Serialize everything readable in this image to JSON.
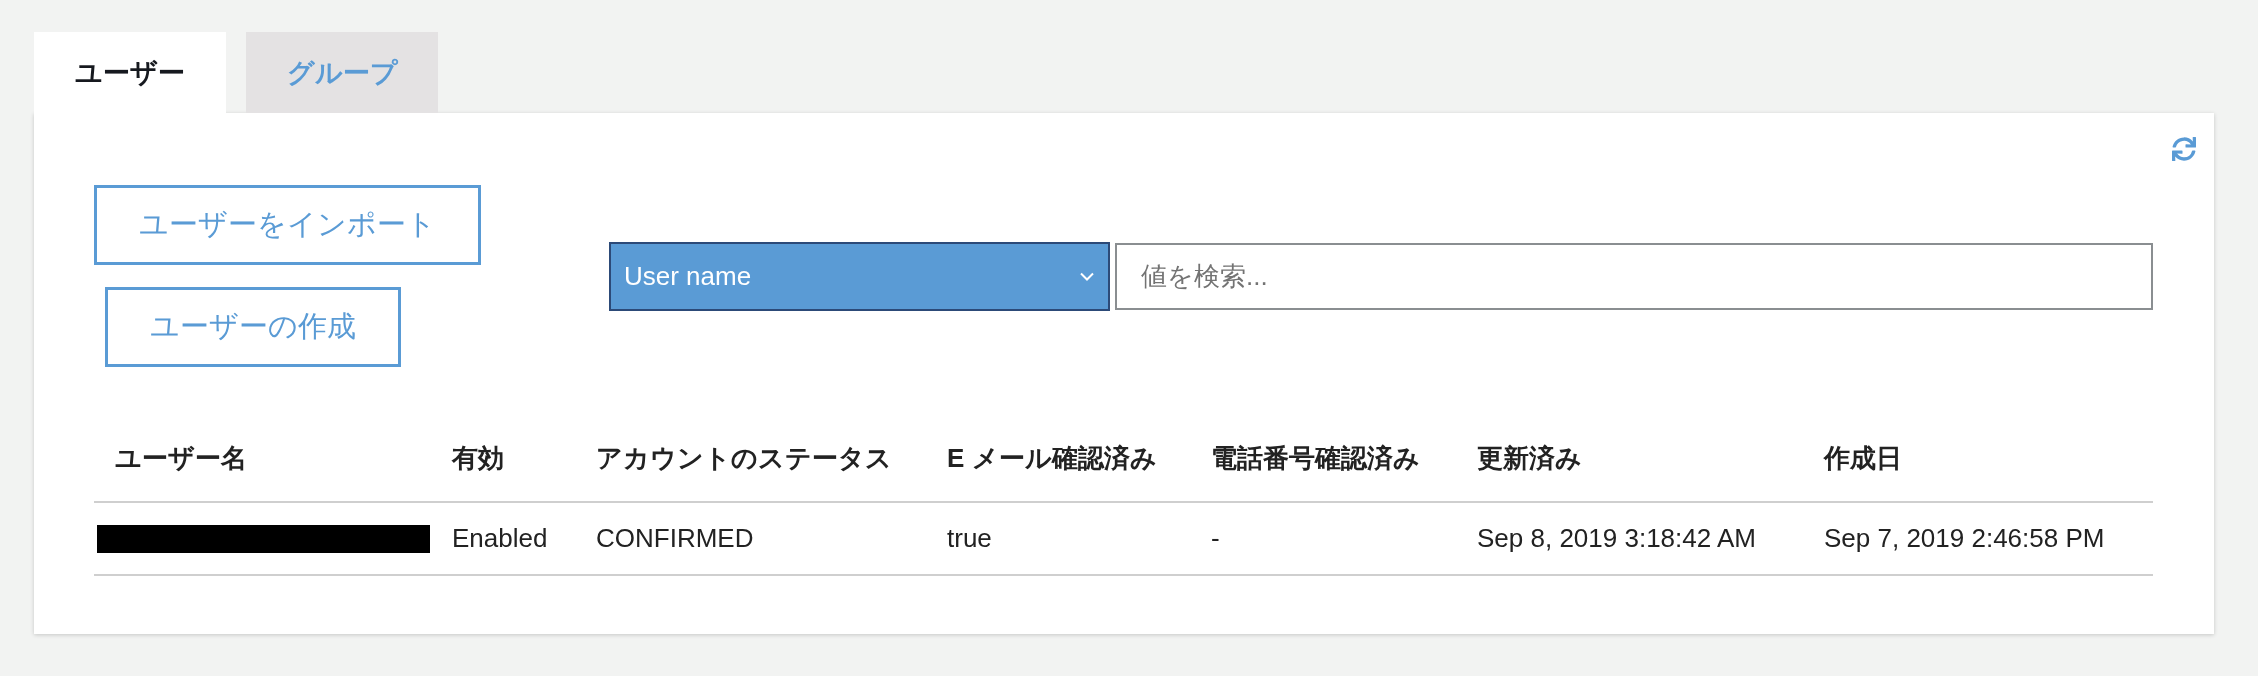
{
  "tabs": [
    {
      "label": "ユーザー",
      "selected": true
    },
    {
      "label": "グループ",
      "selected": false
    }
  ],
  "actions": [
    "ユーザーをインポート",
    "ユーザーの作成"
  ],
  "filter": {
    "attribute": "User name",
    "search": {
      "placeholder": "値を検索..."
    }
  },
  "table": {
    "columns": [
      "ユーザー名",
      "有効",
      "アカウントのステータス",
      "E メール確認済み",
      "電話番号確認済み",
      "更新済み",
      "作成日"
    ],
    "rows": [
      {
        "user_name_redacted": true,
        "cells": [
          "",
          "Enabled",
          "CONFIRMED",
          "true",
          "-",
          "Sep 8, 2019 3:18:42 AM",
          "Sep 7, 2019 2:46:58 PM"
        ]
      }
    ]
  }
}
